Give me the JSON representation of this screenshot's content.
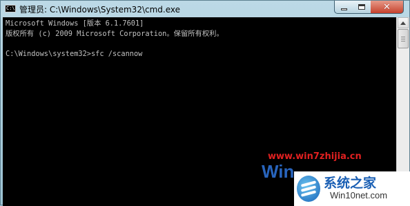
{
  "window": {
    "title": "管理员: C:\\Windows\\System32\\cmd.exe",
    "app_icon_text": "C:\\",
    "controls": {
      "close_glyph": "✕"
    }
  },
  "console": {
    "lines": [
      "Microsoft Windows [版本 6.1.7601]",
      "版权所有 (c) 2009 Microsoft Corporation。保留所有权利。",
      "C:\\Windows\\system32>sfc /scannow"
    ]
  },
  "watermark": {
    "site": "www.win7zhijia.cn",
    "brand_fragment": "Win",
    "badge_name": "系统之家",
    "badge_url": "Win10net.com"
  },
  "colors": {
    "console_bg": "#000000",
    "console_text": "#c0c0c0",
    "close_button": "#c6422d",
    "watermark_red": "#e02020",
    "brand_blue": "#1a5fb4"
  }
}
